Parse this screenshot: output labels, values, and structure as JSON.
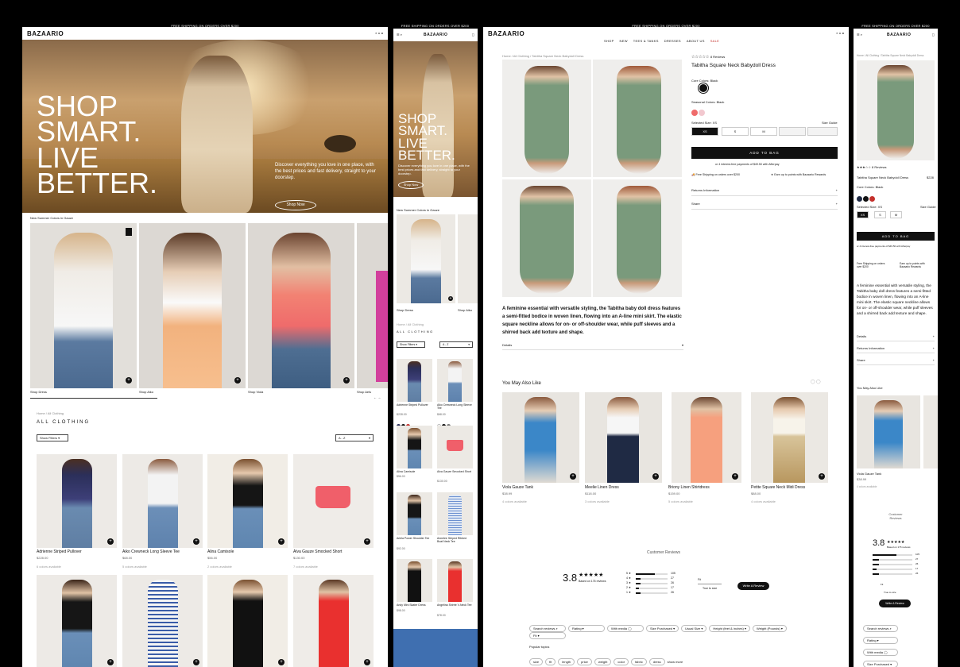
{
  "brand": "BAZAARIO",
  "shipping": "FREE SHIPPING ON ORDERS OVER $200",
  "nav": [
    "SHOP",
    "NEW",
    "TEES & TANKS",
    "DRESSES",
    "ABOUT US",
    "SALE"
  ],
  "hero": {
    "line1": "SHOP",
    "line2": "SMART.",
    "line3": "LIVE",
    "line4": "BETTER.",
    "sub": "Discover everything you love in one place, with the best prices and fast delivery, straight to your doorstep.",
    "cta": "Shop Now"
  },
  "summer": {
    "title": "New Summer Colors in Gauze",
    "items": [
      "Shop Dress",
      "Shop Aiko",
      "Shop Viola",
      "Shop Aels"
    ]
  },
  "catalog": {
    "breadcrumb": "Home / All Clothing",
    "title": "ALL CLOTHING",
    "filters": "Show Filters",
    "sort": "A - Z",
    "products": [
      {
        "name": "Adrienne Striped Pullover",
        "price": "$228.00",
        "note": "6 colors available"
      },
      {
        "name": "Aiko Crewneck Long Sleeve Tee",
        "price": "$68.00",
        "note": "5 colors available"
      },
      {
        "name": "Alina Camisole",
        "price": "$56.00",
        "note": "2 colors available"
      },
      {
        "name": "Alva Gauze Smocked Short",
        "price": "$130.00",
        "note": "7 colors available"
      }
    ]
  },
  "mobile_products": [
    {
      "name": "Adrienne Striped Pullover",
      "price": "$228.00"
    },
    {
      "name": "Aiko Crewneck Long Sleeve Tee",
      "price": "$68.00"
    },
    {
      "name": "Alina Camisole",
      "price": "$56.00"
    },
    {
      "name": "Alva Gauze Smocked Short",
      "price": "$130.00"
    },
    {
      "name": "Ariela Power Shoulder Tee",
      "price": "$92.00"
    },
    {
      "name": "Annelee Striped Ribbed Boat Neck Tee",
      "price": "$88.00"
    },
    {
      "name": "Andy Mini Skater Dress",
      "price": "$98.00"
    },
    {
      "name": "Angelina Shirrie V-Neck Tee",
      "price": "$78.00"
    }
  ],
  "pdp": {
    "breadcrumb": "Home / All Clothing / Tabitha Square Neck Babydoll Dress",
    "reviews": "8 Reviews",
    "title": "Tabitha Square Neck Babydoll Dress",
    "price": "$228",
    "core_label": "Core Colors: Black",
    "seasonal_label": "Seasonal Colors: Black",
    "size_label": "Selected Size: XS",
    "size_guide": "Size Guide",
    "sizes": [
      "XS",
      "S",
      "M"
    ],
    "add": "ADD TO BAG",
    "afterpay": "or 4 interest-free payments of $49.50 with Afterpay",
    "free_ship": "Free Shipping on orders over $200",
    "points": "Earn up to points with Bazaario Rewards",
    "returns": "Returns Information",
    "share": "Share",
    "details": "Details",
    "desc": "A feminine essential with versatile styling, the Tabitha baby doll dress features a semi-fitted bodice in woven linen, flowing into an A-line mini skirt. The elastic square neckline allows for on- or off-shoulder wear, while puff sleeves and a shirred back add texture and shape."
  },
  "also": {
    "title": "You May Also Like",
    "items": [
      {
        "name": "Viola Gauze Tank",
        "price": "$38.99",
        "note": "4 colors available"
      },
      {
        "name": "Meelie Linen Dress",
        "price": "$118.00",
        "note": "3 colors available"
      },
      {
        "name": "Briony Linen Shirtdress",
        "price": "$159.00",
        "note": "5 colors available"
      },
      {
        "name": "Petite Square Neck Midi Dress",
        "price": "$88.00",
        "note": "4 colors available"
      }
    ]
  },
  "reviews": {
    "title": "Customer Reviews",
    "score": "3.8",
    "based": "Based on 176 reviews",
    "counts": [
      "105",
      "27",
      "26",
      "17",
      "26"
    ],
    "fit": "Fit",
    "true_size": "True to size",
    "write": "Write A Review",
    "search": "Search reviews",
    "filters": [
      "Rating",
      "With media",
      "Size Purchased",
      "Usual Size",
      "Height (feet & inches)",
      "Weight (Pounds)",
      "Fit"
    ],
    "popular": "Popular topics",
    "topics": [
      "size",
      "fit",
      "length",
      "price",
      "weight",
      "color",
      "fabric",
      "dress",
      "show more"
    ]
  },
  "colors": {
    "accent": "#c4302b",
    "green": "#7a9a7c",
    "blue": "#3b7fc4",
    "pink": "#ef6b6b"
  }
}
